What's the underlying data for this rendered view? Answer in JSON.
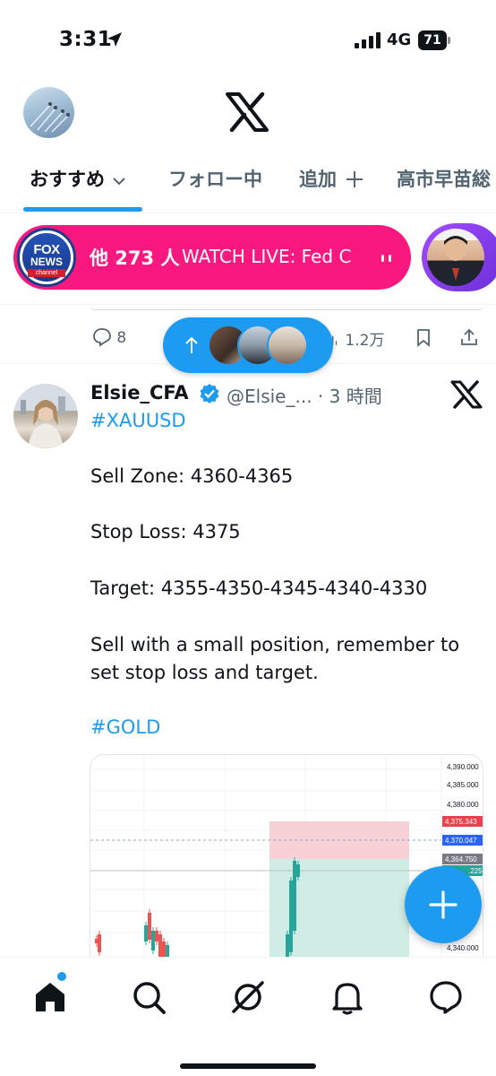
{
  "status_bar": {
    "time": "3:31",
    "network": "4G",
    "battery": "71"
  },
  "tabs": [
    {
      "label": "おすすめ"
    },
    {
      "label": "フォロー中"
    },
    {
      "label": "追加"
    },
    {
      "label": "高市早苗総"
    }
  ],
  "live": {
    "channel_logo_text": "FOX NEWS channel",
    "count": "他 273 人",
    "title": "WATCH LIVE: Fed C"
  },
  "prev_tweet": {
    "replies": "8",
    "views": "1.2万"
  },
  "tweet": {
    "name": "Elsie_CFA",
    "handle": "@Elsie_...",
    "time": "· 3 時間",
    "lines": {
      "tag1": "#XAUUSD",
      "sell_zone": "Sell Zone: 4360-4365",
      "stop_loss": "Stop Loss: 4375",
      "target": "Target: 4355-4350-4345-4340-4330",
      "note1": "Sell with a small position, remember to",
      "note2": "set stop loss and target.",
      "tag2": "#GOLD"
    }
  },
  "chart_data": {
    "type": "candlestick",
    "y_ticks": [
      "4,390.000",
      "4,385.000",
      "4,380.000",
      "4,340.000"
    ],
    "price_labels": [
      {
        "text": "4,375.343",
        "color": "#e8424f"
      },
      {
        "text": "4,370.047",
        "color": "#2962ff"
      },
      {
        "text": "4,364.750",
        "color": "#787b86"
      },
      {
        "text": ".225",
        "color": "#26a69a"
      }
    ],
    "zones": {
      "stop": [
        4364.75,
        4375.343
      ],
      "target": [
        4340,
        4364.75
      ]
    }
  },
  "colors": {
    "accent": "#1d9bf0",
    "live": "#f91880"
  }
}
